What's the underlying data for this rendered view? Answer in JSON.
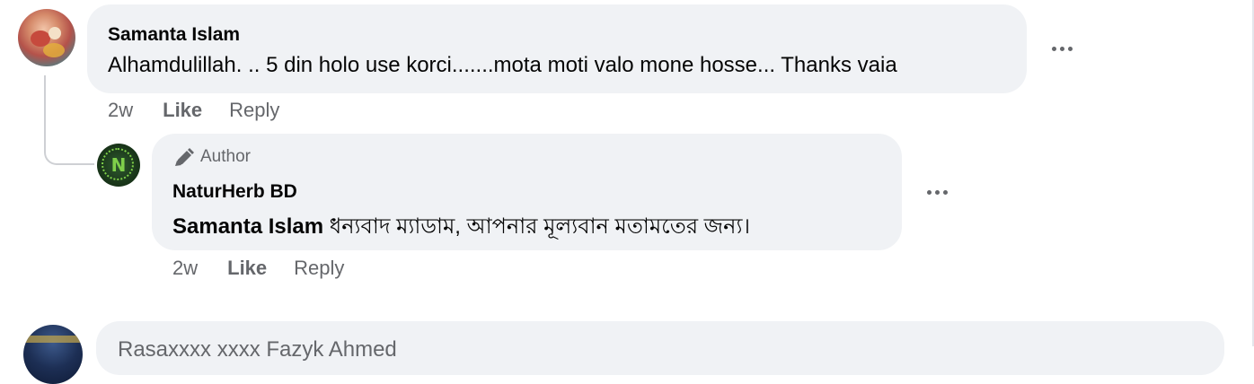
{
  "comments": [
    {
      "author": "Samanta Islam",
      "text": "Alhamdulillah. .. 5 din holo use korci.......mota moti valo mone hosse... Thanks vaia",
      "time": "2w",
      "like_label": "Like",
      "reply_label": "Reply"
    }
  ],
  "reply": {
    "badge_label": "Author",
    "author": "NaturHerb BD",
    "mention": "Samanta Islam",
    "text": " ধন্যবাদ ম্যাডাম, আপনার মূল্যবান মতামতের জন্য।",
    "time": "2w",
    "like_label": "Like",
    "reply_label": "Reply",
    "avatar_letter": "N"
  },
  "next_comment": {
    "partial_text": "Rasaxxxx xxxx Fazyk Ahmed"
  },
  "icons": {
    "more": "more-horizontal-icon",
    "author_badge": "pen-icon"
  },
  "colors": {
    "bubble": "#f0f2f5",
    "meta_text": "#65676b",
    "text": "#050505",
    "connector": "#ced0d4"
  }
}
